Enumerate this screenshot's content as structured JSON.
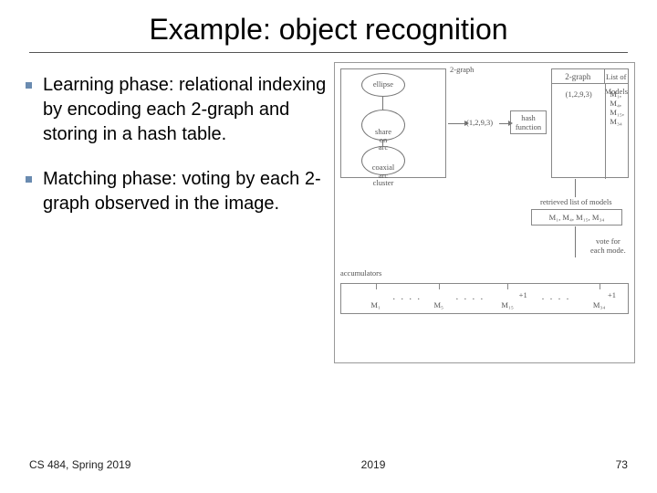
{
  "title": "Example: object recognition",
  "bullets": [
    "Learning phase: relational indexing by encoding each 2-graph and storing in a hash table.",
    "Matching phase: voting by each 2-graph observed in the image."
  ],
  "diagram": {
    "nodes": {
      "top": "ellipse",
      "mid": "share\non\narc",
      "bot": "coaxial\narc\ncluster"
    },
    "two_graph_caption": "2-graph",
    "tuple_in": "(1,2,9,3)",
    "hash_label": "hash\nfunction",
    "tuple_out": "(1,2,9,3)",
    "models_header": {
      "left": "2-graph",
      "right": "List of Models"
    },
    "models_row_left": "(1,2,9,3)",
    "models_row_right": "M₁, M₄, M₁₅, M₃₄",
    "retrieved_caption": "retrieved list of models",
    "retrieved_value": "M₁, M₄, M₁₅, M₃₄",
    "vote_caption": "vote for\neach mode.",
    "accum_label": "accumulators",
    "accum": {
      "marks": [
        "M₁",
        "M₅",
        "M₁₅",
        "M₃₄"
      ],
      "plus": [
        "+1",
        "+1"
      ],
      "dots": ". . . ."
    }
  },
  "footer": {
    "left": "CS 484, Spring 2019",
    "center": "2019",
    "right": "73"
  }
}
